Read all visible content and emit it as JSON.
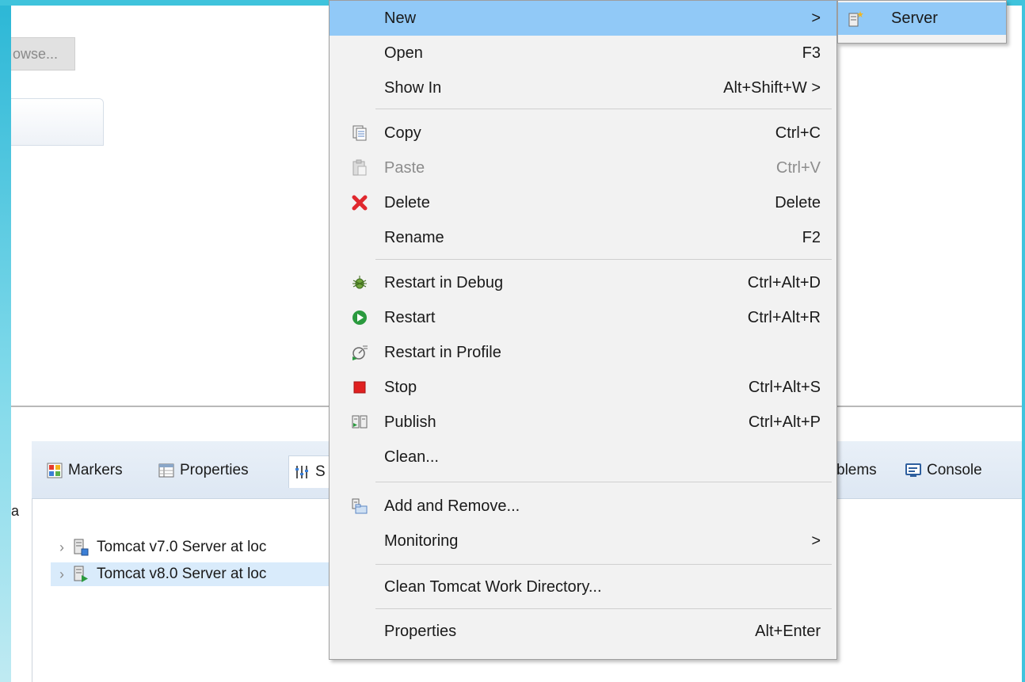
{
  "upper": {
    "browse_label": "owse..."
  },
  "view_tabs": [
    {
      "label": "Markers",
      "icon": "markers-icon"
    },
    {
      "label": "Properties",
      "icon": "properties-icon"
    },
    {
      "label": "S",
      "icon": "servers-icon"
    },
    {
      "label": "blems",
      "icon": "problems-icon"
    },
    {
      "label": "Console",
      "icon": "console-icon"
    }
  ],
  "left_fragment": "a",
  "servers": [
    {
      "label": "Tomcat v7.0 Server at loc",
      "selected": false
    },
    {
      "label": "Tomcat v8.0 Server at loc",
      "selected": true
    }
  ],
  "context_menu": {
    "items": [
      {
        "label": "New",
        "shortcut": "",
        "submenu": true,
        "highlighted": true
      },
      {
        "label": "Open",
        "shortcut": "F3"
      },
      {
        "label": "Show In",
        "shortcut": "Alt+Shift+W",
        "submenu": true
      },
      {
        "label": "Copy",
        "shortcut": "Ctrl+C",
        "icon": "copy-icon"
      },
      {
        "label": "Paste",
        "shortcut": "Ctrl+V",
        "icon": "paste-icon",
        "disabled": true
      },
      {
        "label": "Delete",
        "shortcut": "Delete",
        "icon": "delete-icon"
      },
      {
        "label": "Rename",
        "shortcut": "F2"
      },
      {
        "label": "Restart in Debug",
        "shortcut": "Ctrl+Alt+D",
        "icon": "debug-icon"
      },
      {
        "label": "Restart",
        "shortcut": "Ctrl+Alt+R",
        "icon": "restart-icon"
      },
      {
        "label": "Restart in Profile",
        "shortcut": "",
        "icon": "profile-icon"
      },
      {
        "label": "Stop",
        "shortcut": "Ctrl+Alt+S",
        "icon": "stop-icon"
      },
      {
        "label": "Publish",
        "shortcut": "Ctrl+Alt+P",
        "icon": "publish-icon"
      },
      {
        "label": "Clean...",
        "shortcut": ""
      },
      {
        "label": "Add and Remove...",
        "shortcut": "",
        "icon": "add-remove-icon"
      },
      {
        "label": "Monitoring",
        "shortcut": "",
        "submenu": true
      },
      {
        "label": "Clean Tomcat Work Directory...",
        "shortcut": ""
      },
      {
        "label": "Properties",
        "shortcut": "Alt+Enter"
      }
    ],
    "submenu_arrow": ">",
    "submenu_new": [
      {
        "label": "Server",
        "icon": "new-server-icon"
      }
    ]
  },
  "colors": {
    "highlight": "#91c9f7",
    "frame_accent": "#2bb7d6",
    "delete_red": "#e0282e",
    "restart_green": "#2a9a3e",
    "stop_red": "#e02020"
  }
}
